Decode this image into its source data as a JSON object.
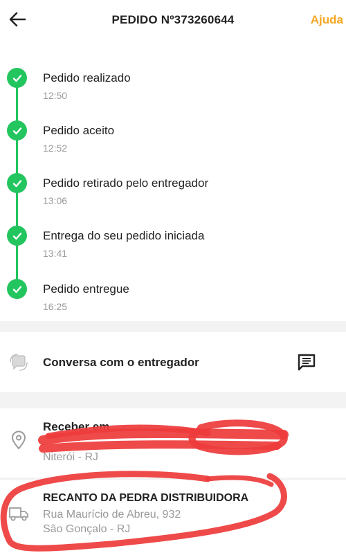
{
  "header": {
    "title": "PEDIDO Nº373260644",
    "help_label": "Ajuda",
    "back_icon": "arrow-left-icon"
  },
  "colors": {
    "accent": "#f5a623",
    "success": "#22c55e",
    "scribble": "#ee3b3b"
  },
  "timeline": [
    {
      "label": "Pedido realizado",
      "time": "12:50"
    },
    {
      "label": "Pedido aceito",
      "time": "12:52"
    },
    {
      "label": "Pedido retirado pelo entregador",
      "time": "13:06"
    },
    {
      "label": "Entrega do seu pedido iniciada",
      "time": "13:41"
    },
    {
      "label": "Pedido entregue",
      "time": "16:25"
    }
  ],
  "chat": {
    "label": "Conversa com o entregador",
    "icon": "chat-bubble-icon",
    "action_icon": "message-icon"
  },
  "address": {
    "title": "Receber em",
    "line2": "Niterói - RJ",
    "icon": "location-pin-icon"
  },
  "store": {
    "name": "RECANTO DA PEDRA DISTRIBUIDORA",
    "line1": "Rua Maurício de Abreu,  932",
    "line2": "São Gonçalo - RJ",
    "icon": "delivery-truck-icon"
  }
}
